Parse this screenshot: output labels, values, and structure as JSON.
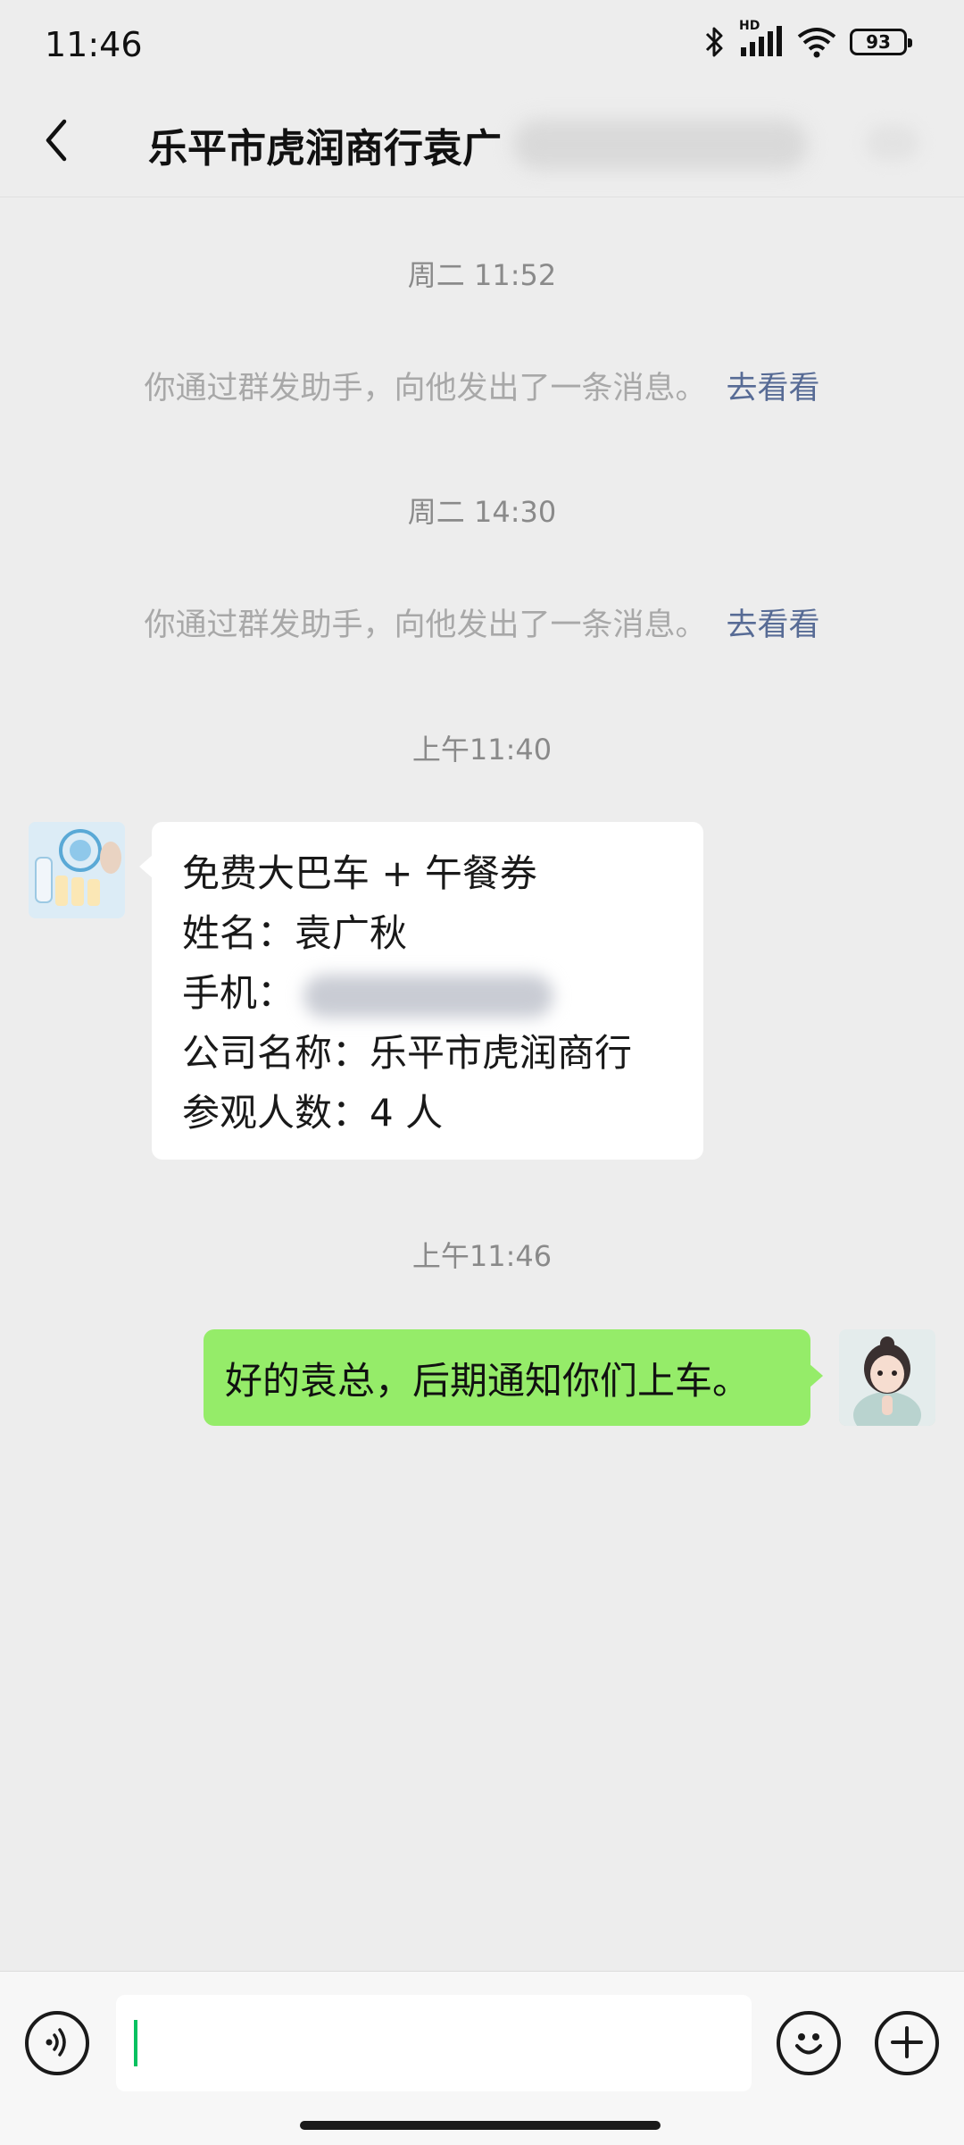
{
  "status_bar": {
    "time": "11:46",
    "network_label": "HD",
    "battery": "93"
  },
  "header": {
    "title": "乐平市虎润商行袁广"
  },
  "messages": {
    "time_1": "周二 11:52",
    "system_1": "你通过群发助手，向他发出了一条消息。",
    "system_1_link": "去看看",
    "time_2": "周二 14:30",
    "system_2": "你通过群发助手，向他发出了一条消息。",
    "system_2_link": "去看看",
    "time_3": "上午11:40",
    "received_lines": [
      "免费大巴车 + 午餐券",
      "姓名：袁广秋",
      "手机：",
      "公司名称：乐平市虎润商行",
      "参观人数：4 人"
    ],
    "time_4": "上午11:46",
    "sent_text": "好的袁总，后期通知你们上车。"
  },
  "icons": {
    "back": "chevron-left-icon",
    "bluetooth": "bluetooth-icon",
    "signal": "signal-icon",
    "wifi": "wifi-icon",
    "battery": "battery-icon",
    "voice": "voice-icon",
    "emoji": "emoji-icon",
    "plus": "plus-icon"
  },
  "colors": {
    "background": "#ededed",
    "sent_bubble": "#95ec69",
    "received_bubble": "#ffffff",
    "link": "#576b95",
    "caret": "#07c160"
  }
}
